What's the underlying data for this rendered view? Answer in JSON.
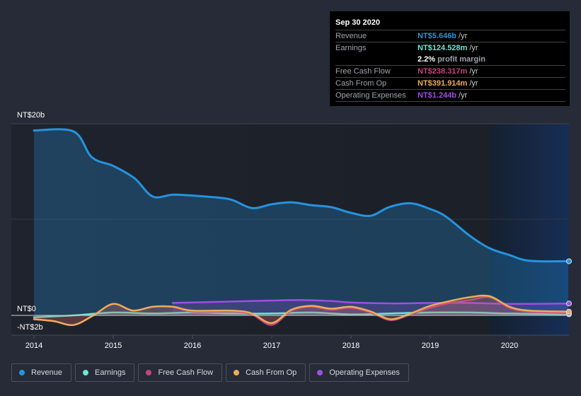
{
  "tooltip": {
    "date": "Sep 30 2020",
    "rows": [
      {
        "label": "Revenue",
        "value": "NT$5.646b",
        "unit": "/yr",
        "color": "#2394df"
      },
      {
        "label": "Earnings",
        "value": "NT$124.528m",
        "unit": "/yr",
        "color": "#6ce5d1"
      },
      {
        "label": "",
        "value": "2.2%",
        "unit": "profit margin",
        "color": "#ffffff"
      },
      {
        "label": "Free Cash Flow",
        "value": "NT$238.317m",
        "unit": "/yr",
        "color": "#c4457d"
      },
      {
        "label": "Cash From Op",
        "value": "NT$391.914m",
        "unit": "/yr",
        "color": "#eeab5a"
      },
      {
        "label": "Operating Expenses",
        "value": "NT$1.244b",
        "unit": "/yr",
        "color": "#9f4ee6"
      }
    ]
  },
  "legend": [
    {
      "label": "Revenue",
      "color": "#2394df"
    },
    {
      "label": "Earnings",
      "color": "#6ce5d1"
    },
    {
      "label": "Free Cash Flow",
      "color": "#c4457d"
    },
    {
      "label": "Cash From Op",
      "color": "#eeab5a"
    },
    {
      "label": "Operating Expenses",
      "color": "#9f4ee6"
    }
  ],
  "chart_data": {
    "type": "area",
    "title": "",
    "xlabel": "",
    "ylabel": "",
    "y_tick_labels": [
      "NT$20b",
      "NT$0",
      "-NT$2b"
    ],
    "y_ticks": [
      20,
      0,
      -2
    ],
    "ylim": [
      -2,
      20
    ],
    "x_tick_labels": [
      "2014",
      "2015",
      "2016",
      "2017",
      "2018",
      "2019",
      "2020"
    ],
    "x_ticks": [
      2014,
      2015,
      2016,
      2017,
      2018,
      2019,
      2020
    ],
    "xlim": [
      2013.7,
      2020.75
    ],
    "highlight_start": 2019.75,
    "units": "NT$ billions",
    "series": [
      {
        "name": "Revenue",
        "color": "#2394df",
        "x": [
          2014.0,
          2014.5,
          2014.73,
          2015.0,
          2015.27,
          2015.5,
          2015.77,
          2016.17,
          2016.48,
          2016.75,
          2017.0,
          2017.25,
          2017.5,
          2017.75,
          2018.0,
          2018.25,
          2018.48,
          2018.75,
          2019.0,
          2019.2,
          2019.5,
          2019.75,
          2020.0,
          2020.25,
          2020.75
        ],
        "values": [
          19.3,
          19.2,
          16.5,
          15.6,
          14.3,
          12.4,
          12.6,
          12.4,
          12.1,
          11.2,
          11.6,
          11.8,
          11.5,
          11.3,
          10.7,
          10.4,
          11.3,
          11.7,
          11.1,
          10.3,
          8.3,
          7.0,
          6.3,
          5.7,
          5.65
        ]
      },
      {
        "name": "Earnings",
        "color": "#6ce5d1",
        "x": [
          2014.0,
          2014.5,
          2015.0,
          2015.5,
          2016.0,
          2016.5,
          2017.0,
          2017.5,
          2018.0,
          2018.5,
          2019.0,
          2019.5,
          2020.0,
          2020.75
        ],
        "values": [
          -0.2,
          0.0,
          0.3,
          0.2,
          0.3,
          0.2,
          0.2,
          0.3,
          0.1,
          0.2,
          0.3,
          0.3,
          0.2,
          0.12
        ]
      },
      {
        "name": "Free Cash Flow",
        "color": "#c4457d",
        "x": [
          2014.0,
          2014.25,
          2014.5,
          2014.75,
          2015.0,
          2015.25,
          2015.5,
          2015.75,
          2016.0,
          2016.5,
          2016.75,
          2017.0,
          2017.25,
          2017.5,
          2017.75,
          2018.0,
          2018.25,
          2018.5,
          2018.75,
          2019.0,
          2019.25,
          2019.5,
          2019.75,
          2020.0,
          2020.25,
          2020.75
        ],
        "values": [
          -0.4,
          -0.6,
          -1.0,
          0.0,
          1.2,
          0.5,
          0.9,
          0.9,
          0.4,
          0.4,
          0.1,
          -1.0,
          0.5,
          0.9,
          0.6,
          0.8,
          0.3,
          -0.5,
          0.1,
          0.8,
          1.3,
          1.6,
          1.9,
          0.8,
          0.4,
          0.24
        ]
      },
      {
        "name": "Cash From Op",
        "color": "#eeab5a",
        "x": [
          2014.0,
          2014.25,
          2014.5,
          2014.75,
          2015.0,
          2015.25,
          2015.5,
          2015.75,
          2016.0,
          2016.5,
          2016.75,
          2017.0,
          2017.25,
          2017.5,
          2017.75,
          2018.0,
          2018.25,
          2018.5,
          2018.75,
          2019.0,
          2019.25,
          2019.5,
          2019.75,
          2020.0,
          2020.25,
          2020.75
        ],
        "values": [
          -0.4,
          -0.6,
          -1.0,
          0.0,
          1.2,
          0.5,
          0.9,
          0.9,
          0.5,
          0.5,
          0.2,
          -0.8,
          0.6,
          1.0,
          0.7,
          0.9,
          0.4,
          -0.4,
          0.2,
          1.0,
          1.5,
          1.9,
          2.0,
          0.9,
          0.5,
          0.39
        ]
      },
      {
        "name": "Operating Expenses",
        "color": "#9f4ee6",
        "x": [
          2015.75,
          2016.0,
          2016.5,
          2017.0,
          2017.4,
          2017.75,
          2018.0,
          2018.5,
          2019.0,
          2019.5,
          2020.0,
          2020.75
        ],
        "values": [
          1.3,
          1.35,
          1.45,
          1.55,
          1.6,
          1.5,
          1.35,
          1.25,
          1.3,
          1.3,
          1.2,
          1.24
        ]
      }
    ]
  }
}
